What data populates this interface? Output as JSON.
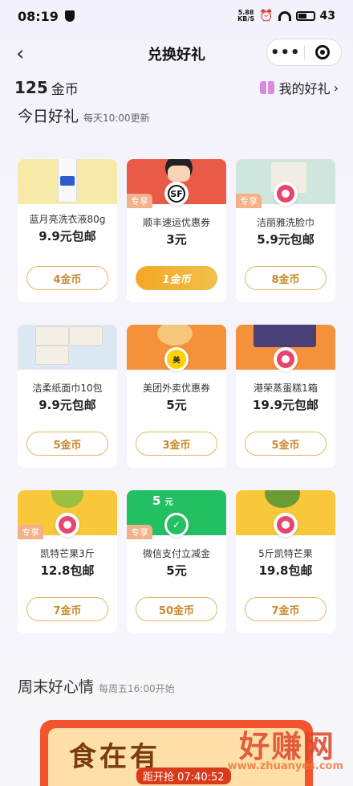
{
  "status_bar": {
    "time": "08:19",
    "net_speed_top": "5.88",
    "net_speed_bottom": "KB/S",
    "battery": "43"
  },
  "nav": {
    "back_icon": "chevron-left-icon",
    "title": "兑换好礼",
    "more_label": "•••"
  },
  "coins": {
    "amount": "125",
    "unit": "金币",
    "my_gifts_label": "我的好礼",
    "my_gifts_arrow": "›"
  },
  "today": {
    "title": "今日好礼",
    "subtitle": "每天10:00更新"
  },
  "colors": {
    "accent": "#e3b663",
    "button_hot": "#f5a623",
    "tag": "#f3b18a"
  },
  "products": [
    {
      "name": "蓝月亮洗衣液80g",
      "price": "9.9元包邮",
      "button": "4金币",
      "tag": "",
      "hot": false,
      "bg": "#f7e9a8"
    },
    {
      "name": "顺丰速运优惠券",
      "price": "3元",
      "button": "1金币",
      "tag": "专享",
      "hot": true,
      "bg": "#e95a47"
    },
    {
      "name": "洁丽雅洗脸巾",
      "price": "5.9元包邮",
      "button": "8金币",
      "tag": "专享",
      "hot": false,
      "bg": "#cfe6de"
    },
    {
      "name": "洁柔纸面巾10包",
      "price": "9.9元包邮",
      "button": "5金币",
      "tag": "",
      "hot": false,
      "bg": "#dbe8f4"
    },
    {
      "name": "美团外卖优惠券",
      "price": "5元",
      "button": "3金币",
      "tag": "",
      "hot": false,
      "bg": "#f6913b"
    },
    {
      "name": "港荣蒸蛋糕1箱",
      "price": "19.9元包邮",
      "button": "5金币",
      "tag": "",
      "hot": false,
      "bg": "#f6913b"
    },
    {
      "name": "凯特芒果3斤",
      "price": "12.8包邮",
      "button": "7金币",
      "tag": "专享",
      "hot": false,
      "bg": "#f8c73a"
    },
    {
      "name": "微信支付立减金",
      "price": "5元",
      "button": "50金币",
      "tag": "专享",
      "hot": false,
      "bg": "#22c063",
      "voucher_amount": "5",
      "voucher_unit": "元"
    },
    {
      "name": "5斤凯特芒果",
      "price": "19.8包邮",
      "button": "7金币",
      "tag": "",
      "hot": false,
      "bg": "#f8c73a"
    }
  ],
  "weekend": {
    "title": "周末好心情",
    "subtitle": "每周五16:00开始"
  },
  "banner": {
    "headline": "食在有",
    "timer": "距开抢 07:40:52"
  },
  "watermark": {
    "text": "好赚网",
    "url": "www.zhuanyes.com"
  }
}
